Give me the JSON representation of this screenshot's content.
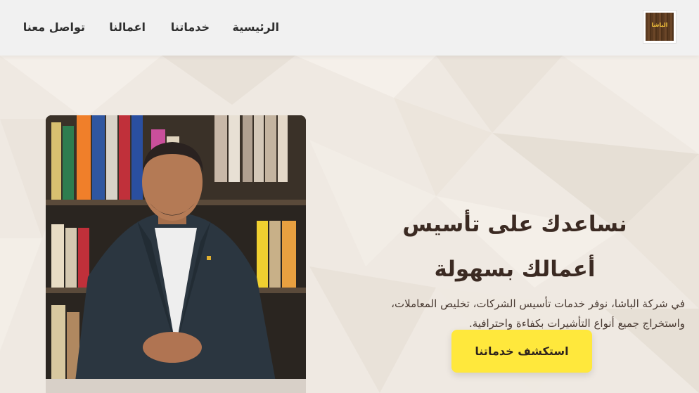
{
  "header": {
    "logo": {
      "icon": "al-basha-logo",
      "text": "الباشا"
    },
    "nav": [
      {
        "label": "الرئيسية"
      },
      {
        "label": "خدماتنا"
      },
      {
        "label": "اعمالنا"
      },
      {
        "label": "تواصل معنا"
      }
    ]
  },
  "hero": {
    "title": "نساعدك على تأسيس أعمالك بسهولة",
    "description": "في شركة الباشا، نوفر خدمات تأسيس الشركات، تخليص المعاملات، واستخراج جميع أنواع التأشيرات بكفاءة واحترافية.",
    "cta_label": "استكشف خدماتنا",
    "photo": {
      "icon": "founder-portrait"
    }
  },
  "colors": {
    "accent": "#ffe83c",
    "heading": "#3b2a22",
    "header_bg": "#f1f1f1",
    "page_bg": "#f1ece6"
  }
}
